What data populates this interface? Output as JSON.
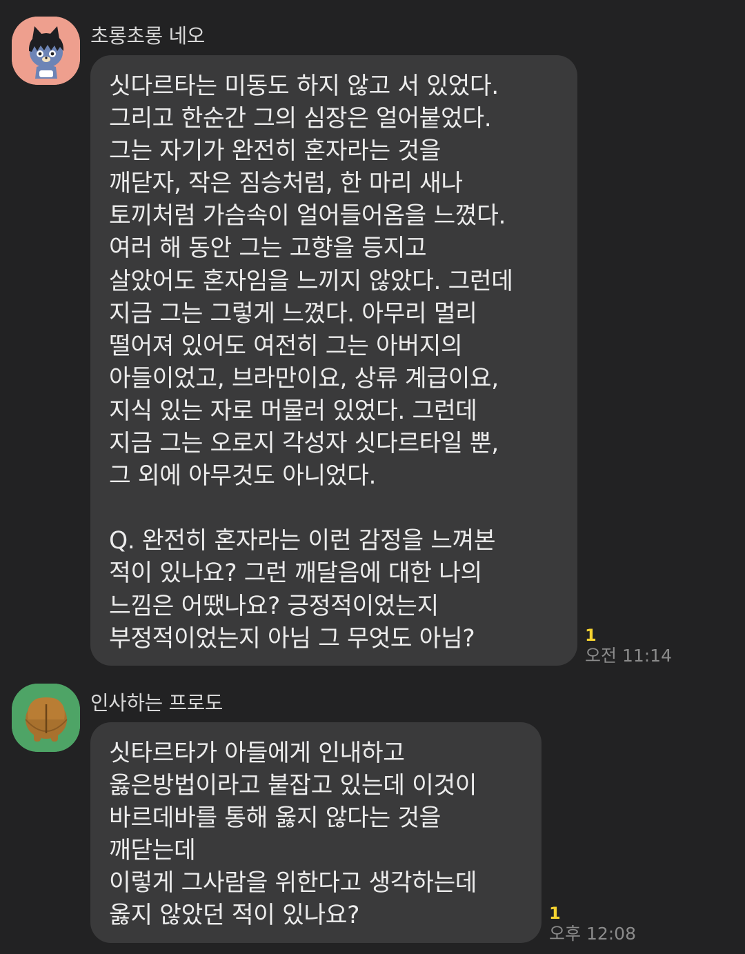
{
  "colors": {
    "background": "#222223",
    "bubble": "#3a3a3b",
    "unread_badge": "#f6d330",
    "timestamp": "#8b8b8b"
  },
  "messages": [
    {
      "sender": "초롱초롱 네오",
      "avatar_icon": "neo-character-avatar-icon",
      "text": "싯다르타는 미동도 하지 않고 서 있었다.\n그리고 한순간 그의 심장은 얼어붙었다.\n그는 자기가 완전히 혼자라는 것을\n깨닫자, 작은 짐승처럼, 한 마리 새나\n토끼처럼 가슴속이 얼어들어옴을 느꼈다.\n여러 해 동안 그는 고향을 등지고\n살았어도 혼자임을 느끼지 않았다. 그런데\n지금 그는 그렇게 느꼈다. 아무리 멀리\n떨어져 있어도 여전히 그는 아버지의\n아들이었고, 브라만이요, 상류 계급이요,\n지식 있는 자로 머물러 있었다. 그런데\n지금 그는 오로지 각성자 싯다르타일 뿐,\n그 외에 아무것도 아니었다.\n\nQ. 완전히 혼자라는 이런 감정을 느껴본\n적이 있나요? 그런 깨달음에 대한 나의\n느낌은 어땠나요? 긍정적이었는지\n부정적이었는지 아님 그 무엇도 아님?",
      "unread": "1",
      "time": "오전 11:14"
    },
    {
      "sender": "인사하는 프로도",
      "avatar_icon": "frodo-character-avatar-icon",
      "text": "싯타르타가 아들에게 인내하고\n옳은방법이라고 붙잡고 있는데 이것이\n바르데바를 통해 옳지 않다는 것을\n깨닫는데\n이렇게 그사람을 위한다고 생각하는데\n옳지 않았던 적이 있나요?",
      "unread": "1",
      "time": "오후 12:08"
    }
  ]
}
